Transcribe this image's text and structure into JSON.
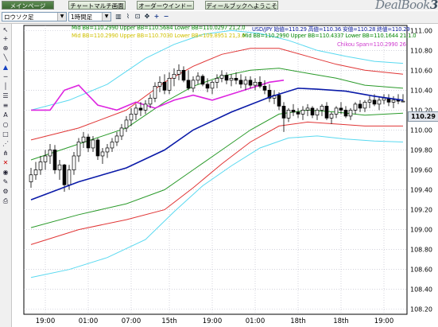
{
  "tabs": [
    {
      "label": "メインページ",
      "active": true
    },
    {
      "label": "チャートマルチ画面",
      "active": false
    },
    {
      "label": "オーダーウインドー",
      "active": false
    },
    {
      "label": "ディールブックへようこそ",
      "active": false
    }
  ],
  "brand": {
    "text": "DealBook",
    "suffix": "360"
  },
  "toolbar": {
    "currency_select": "ロウソク足",
    "timeframe_select": "1時間足",
    "icons": [
      "bar-chart-icon",
      "line-chart-icon",
      "fit-icon",
      "move-icon",
      "zoom-in-icon",
      "zoom-out-icon"
    ]
  },
  "left_tools": [
    "cursor-icon",
    "crosshair-icon",
    "zoom-icon",
    "trendline-icon",
    "up-arrow-icon",
    "horizontal-line-icon",
    "vertical-line-icon",
    "channel-icon",
    "fibonacci-icon",
    "text-icon",
    "ellipse-icon",
    "rectangle-icon",
    "gann-icon",
    "pitchfork-icon",
    "delete-icon",
    "eye-icon",
    "pen-icon",
    "settings-icon",
    "print-icon"
  ],
  "legends": {
    "bb1": "Mid BB=110.2990 Upper BB=110.5684 Lower BB=110.0297 21,2.0",
    "quote": "USD/JPY 始値=110.29 高値=110.36 安値=110.28 終値=110.29",
    "bb2_left": "Mid BB=110.2990 Upper BB=110.7030 Lower BB=109.8951 21,3.0",
    "bb2_right": "Mid BB=110.2990 Upper BB=110.4337 Lower BB=110.1644 21,1.0",
    "chikou": "Chikou Span=110.2990 26"
  },
  "colors": {
    "grid": "#b7b7c8",
    "mid": "#0a1aa8",
    "bb1": "#2a9a2a",
    "bb2": "#e03535",
    "bb3": "#59d9f0",
    "chikou": "#dd25e0",
    "candle_up": "#ffffff",
    "candle_down": "#000000",
    "legend_bb1": "#0a8a0a",
    "legend_quote": "#1020a0",
    "legend_bb2": "#d0c000",
    "legend_chikou": "#d040d0"
  },
  "current_price": "110.29",
  "chart_data": {
    "type": "candlestick",
    "instrument": "USD/JPY",
    "ylim": [
      108.15,
      111.05
    ],
    "y_ticks": [
      "111.00",
      "110.80",
      "110.60",
      "110.40",
      "110.20",
      "110.00",
      "109.80",
      "109.60",
      "109.40",
      "109.20",
      "109.00",
      "108.80",
      "108.60",
      "108.40",
      "108.20"
    ],
    "x_ticks": [
      "19:00",
      "01:00",
      "07:00",
      "15th",
      "19:00",
      "01:00",
      "18th",
      "18th",
      "19:00"
    ],
    "x_tick_pos": [
      3,
      12,
      21,
      29,
      38,
      47,
      56,
      65,
      74
    ],
    "n_bars": 79,
    "candles": [
      [
        109.48,
        109.62,
        109.42,
        109.55
      ],
      [
        109.55,
        109.68,
        109.5,
        109.6
      ],
      [
        109.6,
        109.74,
        109.55,
        109.68
      ],
      [
        109.68,
        109.8,
        109.6,
        109.74
      ],
      [
        109.74,
        109.86,
        109.66,
        109.8
      ],
      [
        109.8,
        109.85,
        109.56,
        109.6
      ],
      [
        109.6,
        109.7,
        109.5,
        109.65
      ],
      [
        109.65,
        109.66,
        109.38,
        109.45
      ],
      [
        109.45,
        109.65,
        109.4,
        109.6
      ],
      [
        109.6,
        109.78,
        109.55,
        109.74
      ],
      [
        109.74,
        109.92,
        109.68,
        109.88
      ],
      [
        109.88,
        109.98,
        109.82,
        109.93
      ],
      [
        109.93,
        109.96,
        109.78,
        109.82
      ],
      [
        109.82,
        109.94,
        109.78,
        109.9
      ],
      [
        109.9,
        109.92,
        109.7,
        109.74
      ],
      [
        109.74,
        109.82,
        109.66,
        109.78
      ],
      [
        109.78,
        109.86,
        109.72,
        109.82
      ],
      [
        109.82,
        109.92,
        109.78,
        109.88
      ],
      [
        109.88,
        109.98,
        109.84,
        109.94
      ],
      [
        109.94,
        110.06,
        109.9,
        110.02
      ],
      [
        110.02,
        110.14,
        109.98,
        110.1
      ],
      [
        110.1,
        110.22,
        110.04,
        110.16
      ],
      [
        110.16,
        110.26,
        110.1,
        110.22
      ],
      [
        110.22,
        110.28,
        110.14,
        110.2
      ],
      [
        110.2,
        110.3,
        110.16,
        110.26
      ],
      [
        110.26,
        110.36,
        110.22,
        110.32
      ],
      [
        110.32,
        110.48,
        110.28,
        110.44
      ],
      [
        110.44,
        110.54,
        110.38,
        110.48
      ],
      [
        110.48,
        110.56,
        110.36,
        110.4
      ],
      [
        110.4,
        110.58,
        110.36,
        110.52
      ],
      [
        110.52,
        110.62,
        110.44,
        110.56
      ],
      [
        110.56,
        110.66,
        110.5,
        110.6
      ],
      [
        110.6,
        110.64,
        110.48,
        110.5
      ],
      [
        110.5,
        110.6,
        110.4,
        110.42
      ],
      [
        110.42,
        110.54,
        110.38,
        110.5
      ],
      [
        110.5,
        110.58,
        110.46,
        110.54
      ],
      [
        110.54,
        110.56,
        110.44,
        110.46
      ],
      [
        110.46,
        110.52,
        110.38,
        110.42
      ],
      [
        110.42,
        110.5,
        110.36,
        110.48
      ],
      [
        110.48,
        110.56,
        110.42,
        110.52
      ],
      [
        110.52,
        110.6,
        110.48,
        110.55
      ],
      [
        110.55,
        110.58,
        110.46,
        110.5
      ],
      [
        110.5,
        110.56,
        110.44,
        110.52
      ],
      [
        110.52,
        110.58,
        110.46,
        110.5
      ],
      [
        110.5,
        110.56,
        110.42,
        110.46
      ],
      [
        110.46,
        110.54,
        110.4,
        110.5
      ],
      [
        110.5,
        110.54,
        110.42,
        110.45
      ],
      [
        110.45,
        110.52,
        110.4,
        110.48
      ],
      [
        110.48,
        110.54,
        110.42,
        110.44
      ],
      [
        110.44,
        110.5,
        110.36,
        110.4
      ],
      [
        110.4,
        110.46,
        110.28,
        110.32
      ],
      [
        110.32,
        110.4,
        110.26,
        110.35
      ],
      [
        110.35,
        110.38,
        110.2,
        110.24
      ],
      [
        110.24,
        110.28,
        109.98,
        110.12
      ],
      [
        110.12,
        110.22,
        110.08,
        110.2
      ],
      [
        110.2,
        110.26,
        110.14,
        110.18
      ],
      [
        110.18,
        110.22,
        110.12,
        110.16
      ],
      [
        110.16,
        110.24,
        110.1,
        110.2
      ],
      [
        110.2,
        110.26,
        110.14,
        110.22
      ],
      [
        110.22,
        110.24,
        110.12,
        110.15
      ],
      [
        110.15,
        110.22,
        110.1,
        110.2
      ],
      [
        110.2,
        110.26,
        110.14,
        110.24
      ],
      [
        110.24,
        110.28,
        110.1,
        110.12
      ],
      [
        110.12,
        110.18,
        110.06,
        110.16
      ],
      [
        110.16,
        110.24,
        110.12,
        110.22
      ],
      [
        110.22,
        110.28,
        110.16,
        110.2
      ],
      [
        110.2,
        110.24,
        110.12,
        110.14
      ],
      [
        110.14,
        110.22,
        110.1,
        110.2
      ],
      [
        110.2,
        110.28,
        110.16,
        110.26
      ],
      [
        110.26,
        110.3,
        110.18,
        110.22
      ],
      [
        110.22,
        110.3,
        110.18,
        110.28
      ],
      [
        110.28,
        110.34,
        110.22,
        110.3
      ],
      [
        110.3,
        110.36,
        110.24,
        110.26
      ],
      [
        110.26,
        110.34,
        110.2,
        110.3
      ],
      [
        110.3,
        110.36,
        110.26,
        110.32
      ],
      [
        110.32,
        110.36,
        110.24,
        110.28
      ],
      [
        110.28,
        110.34,
        110.22,
        110.3
      ],
      [
        110.3,
        110.36,
        110.26,
        110.29
      ],
      [
        110.29,
        110.36,
        110.28,
        110.29
      ]
    ],
    "mid": [
      [
        0,
        109.3
      ],
      [
        10,
        109.48
      ],
      [
        20,
        109.62
      ],
      [
        28,
        109.8
      ],
      [
        34,
        110.0
      ],
      [
        42,
        110.18
      ],
      [
        50,
        110.33
      ],
      [
        56,
        110.42
      ],
      [
        60,
        110.41
      ],
      [
        66,
        110.39
      ],
      [
        72,
        110.34
      ],
      [
        78,
        110.3
      ]
    ],
    "bb1_upper": [
      [
        0,
        109.7
      ],
      [
        10,
        109.86
      ],
      [
        20,
        110.02
      ],
      [
        28,
        110.28
      ],
      [
        34,
        110.44
      ],
      [
        40,
        110.54
      ],
      [
        46,
        110.6
      ],
      [
        52,
        110.62
      ],
      [
        58,
        110.57
      ],
      [
        64,
        110.52
      ],
      [
        70,
        110.45
      ],
      [
        78,
        110.42
      ]
    ],
    "bb1_lower": [
      [
        0,
        109.02
      ],
      [
        10,
        109.15
      ],
      [
        20,
        109.26
      ],
      [
        28,
        109.4
      ],
      [
        34,
        109.6
      ],
      [
        40,
        109.8
      ],
      [
        46,
        110.0
      ],
      [
        52,
        110.16
      ],
      [
        58,
        110.2
      ],
      [
        64,
        110.18
      ],
      [
        70,
        110.15
      ],
      [
        78,
        110.17
      ]
    ],
    "bb2_upper": [
      [
        0,
        109.9
      ],
      [
        10,
        110.02
      ],
      [
        20,
        110.2
      ],
      [
        28,
        110.48
      ],
      [
        34,
        110.64
      ],
      [
        40,
        110.76
      ],
      [
        46,
        110.82
      ],
      [
        52,
        110.82
      ],
      [
        58,
        110.74
      ],
      [
        64,
        110.66
      ],
      [
        70,
        110.6
      ],
      [
        78,
        110.56
      ]
    ],
    "bb2_lower": [
      [
        0,
        108.85
      ],
      [
        10,
        109.0
      ],
      [
        20,
        109.1
      ],
      [
        28,
        109.2
      ],
      [
        34,
        109.42
      ],
      [
        40,
        109.66
      ],
      [
        46,
        109.88
      ],
      [
        52,
        110.04
      ],
      [
        58,
        110.08
      ],
      [
        64,
        110.06
      ],
      [
        70,
        110.04
      ],
      [
        78,
        110.04
      ]
    ],
    "bb3_upper": [
      [
        0,
        110.2
      ],
      [
        8,
        110.3
      ],
      [
        16,
        110.46
      ],
      [
        24,
        110.72
      ],
      [
        30,
        110.86
      ],
      [
        36,
        110.96
      ],
      [
        42,
        111.0
      ],
      [
        48,
        110.97
      ],
      [
        54,
        110.9
      ],
      [
        60,
        110.8
      ],
      [
        66,
        110.74
      ],
      [
        72,
        110.69
      ],
      [
        78,
        110.67
      ]
    ],
    "bb3_lower": [
      [
        0,
        108.52
      ],
      [
        8,
        108.6
      ],
      [
        16,
        108.72
      ],
      [
        24,
        108.9
      ],
      [
        30,
        109.18
      ],
      [
        36,
        109.44
      ],
      [
        42,
        109.64
      ],
      [
        48,
        109.82
      ],
      [
        54,
        109.92
      ],
      [
        60,
        109.94
      ],
      [
        66,
        109.91
      ],
      [
        72,
        109.89
      ],
      [
        78,
        109.88
      ]
    ],
    "chikou": [
      [
        0,
        110.2
      ],
      [
        4,
        110.2
      ],
      [
        7,
        110.4
      ],
      [
        10,
        110.45
      ],
      [
        14,
        110.25
      ],
      [
        18,
        110.2
      ],
      [
        22,
        110.28
      ],
      [
        26,
        110.22
      ],
      [
        30,
        110.3
      ],
      [
        34,
        110.35
      ],
      [
        38,
        110.3
      ],
      [
        42,
        110.36
      ],
      [
        46,
        110.42
      ],
      [
        50,
        110.48
      ],
      [
        53,
        110.5
      ]
    ]
  }
}
